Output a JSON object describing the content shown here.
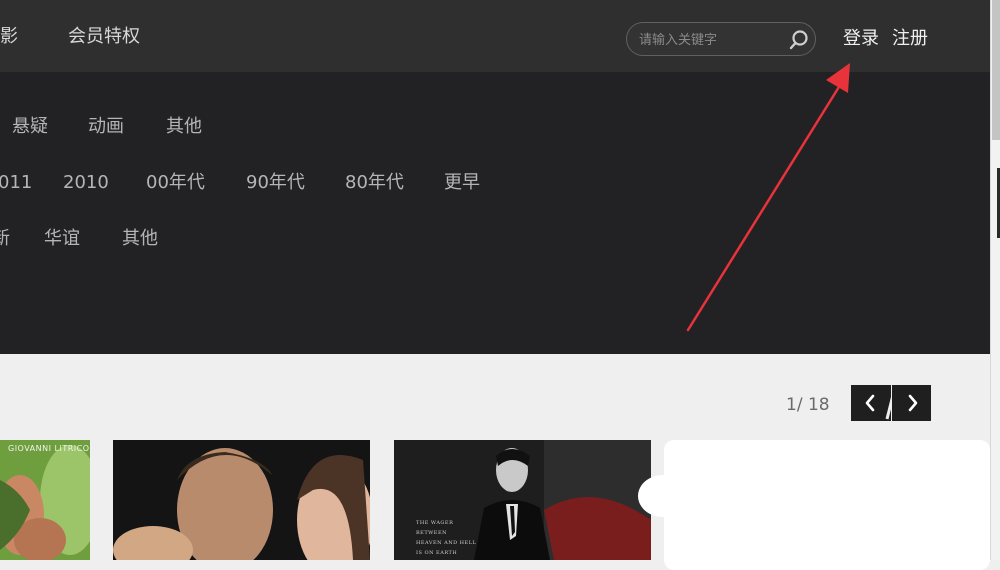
{
  "header": {
    "nav": [
      "影",
      "会员特权"
    ],
    "search": {
      "placeholder": "请输入关键字"
    },
    "auth": {
      "login": "登录",
      "register": "注册"
    }
  },
  "filters": {
    "genre_row": [
      "悬疑",
      "动画",
      "其他"
    ],
    "year_row": [
      "011",
      "2010",
      "00年代",
      "90年代",
      "80年代",
      "更早"
    ],
    "region_row": [
      "新",
      "华谊",
      "其他"
    ]
  },
  "pagination": {
    "text": "1/ 18"
  },
  "posters": [
    {
      "brand_text": "GIOVANNI LITRICO"
    },
    {
      "brand_text": ""
    },
    {
      "tagline": [
        "THE WAGER",
        "BETWEEN",
        "HEAVEN AND HELL",
        "IS ON EARTH"
      ]
    }
  ],
  "colors": {
    "topbar": "#2f2f2f",
    "filter_panel": "#222225",
    "annotation_arrow": "#e8333a"
  },
  "icons": [
    "search-icon",
    "chevron-left-icon",
    "chevron-right-icon"
  ]
}
